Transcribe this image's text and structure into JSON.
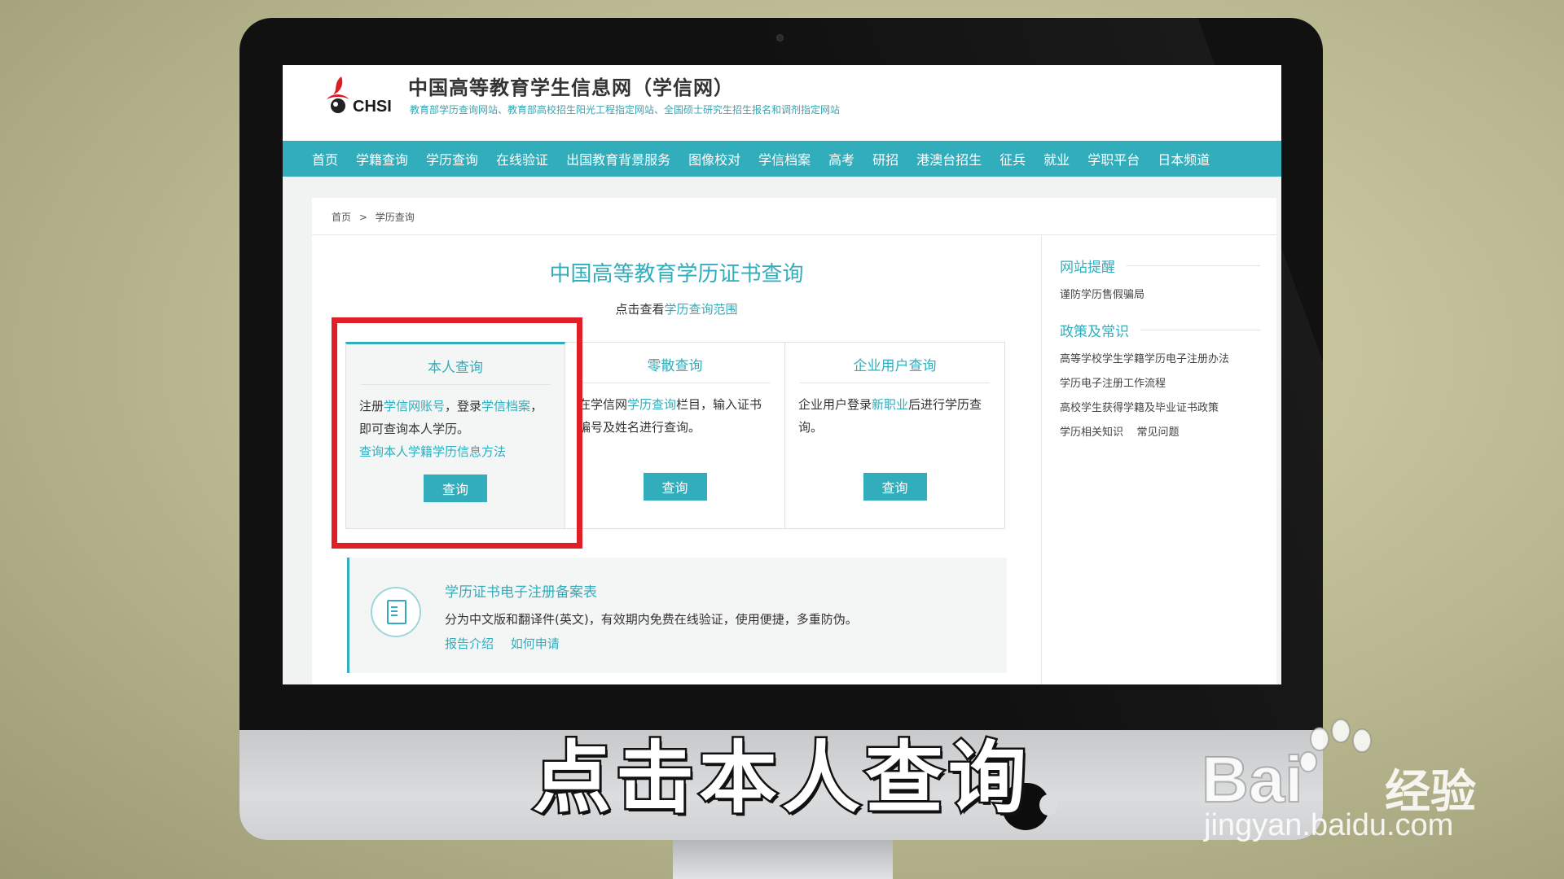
{
  "site": {
    "logo_text": "CHSI",
    "title": "中国高等教育学生信息网（学信网）",
    "subtitle": "教育部学历查询网站、教育部高校招生阳光工程指定网站、全国硕士研究生招生报名和调剂指定网站"
  },
  "nav": {
    "items": [
      "首页",
      "学籍查询",
      "学历查询",
      "在线验证",
      "出国教育背景服务",
      "图像校对",
      "学信档案",
      "高考",
      "研招",
      "港澳台招生",
      "征兵",
      "就业",
      "学职平台",
      "日本频道"
    ]
  },
  "breadcrumb": {
    "home": "首页",
    "sep": ">",
    "current": "学历查询"
  },
  "main": {
    "heading": "中国高等教育学历证书查询",
    "scope_prefix": "点击查看",
    "scope_link": "学历查询范围",
    "cards": [
      {
        "title": "本人查询",
        "desc_parts": [
          "注册",
          "学信网账号",
          "，登录",
          "学信档案",
          "，即可查询本人学历。"
        ],
        "link": "查询本人学籍学历信息方法",
        "button": "查询"
      },
      {
        "title": "零散查询",
        "desc_parts": [
          "在学信网",
          "学历查询",
          "栏目，输入证书编号及姓名进行查询。"
        ],
        "button": "查询"
      },
      {
        "title": "企业用户查询",
        "desc_parts": [
          "企业用户登录",
          "新职业",
          "后进行学历查询。"
        ],
        "button": "查询"
      }
    ],
    "cert": {
      "title": "学历证书电子注册备案表",
      "desc": "分为中文版和翻译件(英文)，有效期内免费在线验证，使用便捷，多重防伪。",
      "links": [
        "报告介绍",
        "如何申请"
      ]
    }
  },
  "sidebar": {
    "reminder_heading": "网站提醒",
    "reminder_items": [
      "谨防学历售假骗局"
    ],
    "policy_heading": "政策及常识",
    "policy_items": [
      "高等学校学生学籍学历电子注册办法",
      "学历电子注册工作流程",
      "高校学生获得学籍及毕业证书政策",
      "学历相关知识"
    ],
    "faq": "常见问题"
  },
  "caption": "点击本人查询",
  "watermark": {
    "brand": "Bai",
    "brand2": "经验",
    "url": "jingyan.baidu.com"
  },
  "colors": {
    "accent": "#31adbc",
    "highlight": "#e01f26",
    "logo_red": "#d81e27"
  },
  "icons": [
    "chsi-logo-icon",
    "certificate-icon",
    "apple-logo-icon",
    "baidu-paw-icon"
  ]
}
